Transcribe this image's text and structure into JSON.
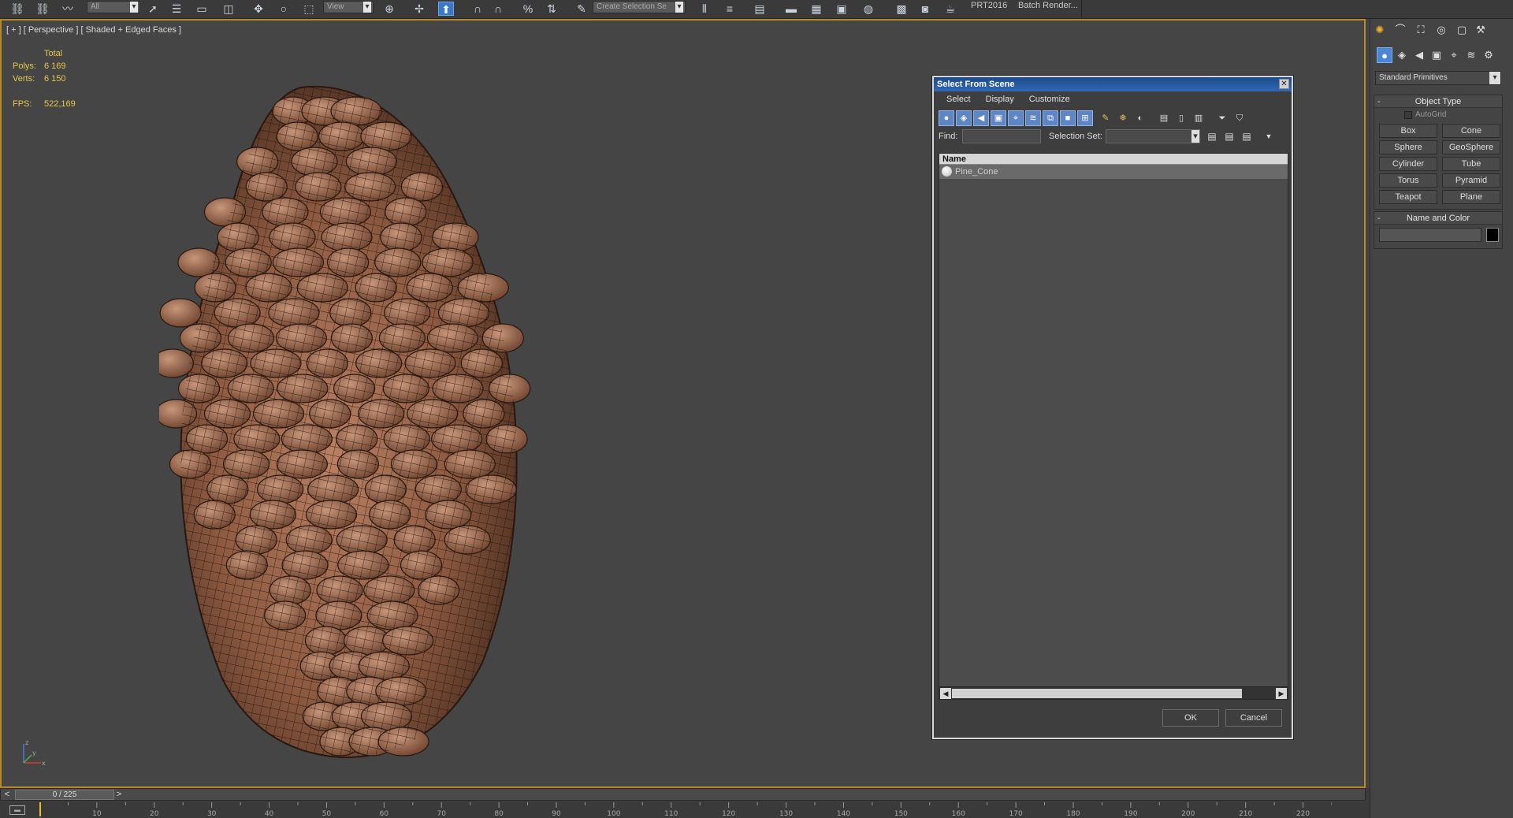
{
  "toolbar": {
    "dropdown_filter": "All",
    "dropdown_view": "View",
    "dropdown_selection_set": "Create Selection Se",
    "prt_label": "PRT2016",
    "batch_render_label": "Batch Render..."
  },
  "viewport": {
    "label": "[ + ] [ Perspective ] [ Shaded + Edged Faces ]",
    "stats": {
      "total_label": "Total",
      "polys_label": "Polys:",
      "polys_value": "6 169",
      "verts_label": "Verts:",
      "verts_value": "6 150",
      "fps_label": "FPS:",
      "fps_value": "522,169"
    },
    "axis": {
      "x": "x",
      "y": "y",
      "z": "z"
    }
  },
  "dialog": {
    "title": "Select From Scene",
    "close_glyph": "✕",
    "menu": [
      "Select",
      "Display",
      "Customize"
    ],
    "find_label": "Find:",
    "find_value": "",
    "selection_set_label": "Selection Set:",
    "list_header": "Name",
    "rows": [
      {
        "name": "Pine_Cone"
      }
    ],
    "ok_label": "OK",
    "cancel_label": "Cancel"
  },
  "command_panel": {
    "category_dropdown": "Standard Primitives",
    "object_type_title": "Object Type",
    "autogrid_label": "AutoGrid",
    "primitives": [
      "Box",
      "Cone",
      "Sphere",
      "GeoSphere",
      "Cylinder",
      "Tube",
      "Torus",
      "Pyramid",
      "Teapot",
      "Plane"
    ],
    "name_color_title": "Name and Color",
    "color_swatch": "#000000"
  },
  "timeline": {
    "frame_display": "0 / 225",
    "prev_glyph": "<",
    "next_glyph": ">",
    "ticks": [
      10,
      20,
      30,
      40,
      50,
      60,
      70,
      80,
      90,
      100,
      110,
      120,
      130,
      140,
      150,
      160,
      170,
      180,
      190,
      200,
      210,
      220
    ]
  },
  "colors": {
    "viewport_border": "#b58a2a",
    "stats_text": "#e6c84a",
    "title_bar": "#2f69b8",
    "active_button": "#3c78c8"
  }
}
